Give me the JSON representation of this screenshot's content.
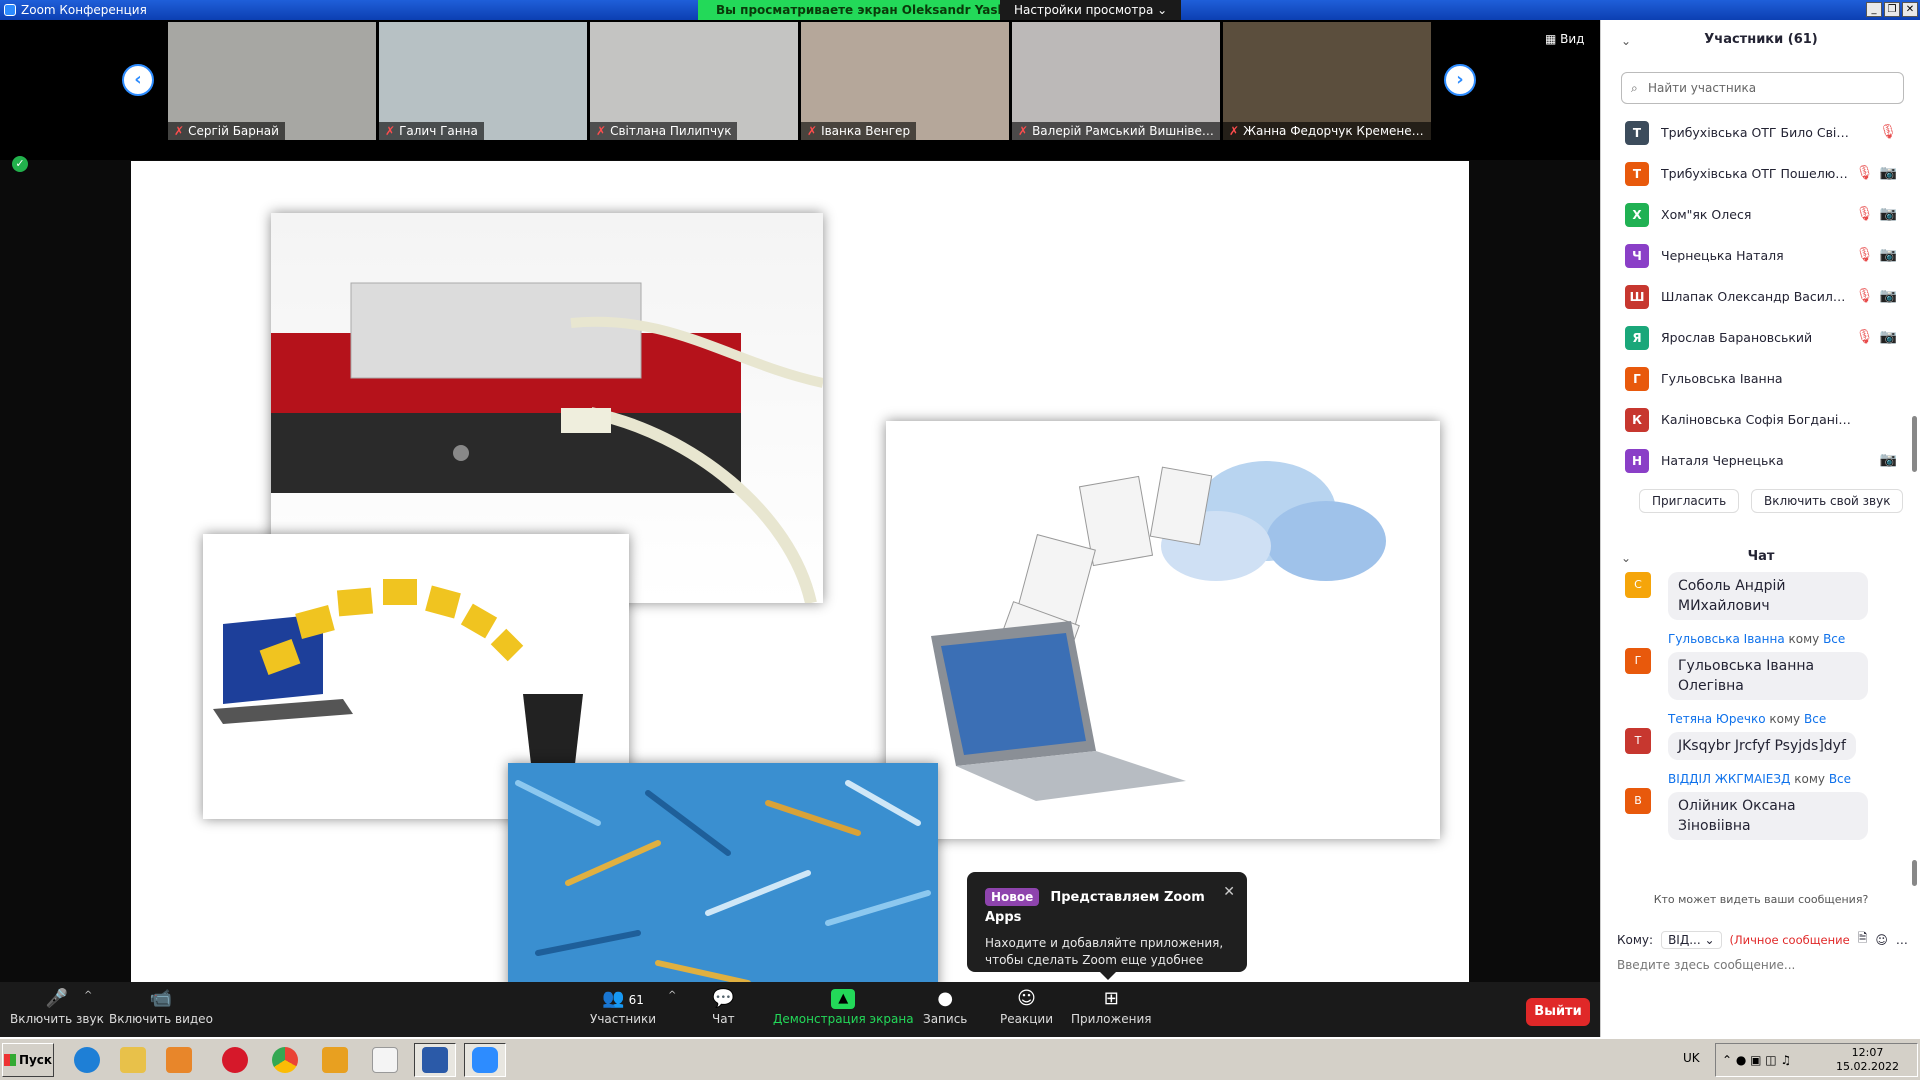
{
  "window": {
    "title": "Zoom Конференция",
    "min_glyph": "_",
    "max_glyph": "❐",
    "close_glyph": "✕"
  },
  "share_banner": "Вы просматриваете экран Oleksandr Yashchyk",
  "view_options": "Настройки просмотра ⌄",
  "view_button": "▦ Вид",
  "gallery": {
    "prev_glyph": "‹",
    "next_glyph": "›",
    "tiles": [
      {
        "name": "Сергій Барнай",
        "bg": "#a7a7a3"
      },
      {
        "name": "Галич Ганна",
        "bg": "#b7c1c4"
      },
      {
        "name": "Світлана Пилипчук",
        "bg": "#c4c4c2"
      },
      {
        "name": "Іванка Венгер",
        "bg": "#b5a79a"
      },
      {
        "name": "Валерій Рамський Вишнівець...",
        "bg": "#bcb9b8"
      },
      {
        "name": "Жанна Федорчук Кременець...",
        "bg": "#5b4e3d"
      }
    ],
    "mute_icon": "mic-off-icon",
    "mute_glyph": "✗"
  },
  "shield_glyph": "✓",
  "popup": {
    "badge": "Новое",
    "title": "Представляем Zoom Apps",
    "close_glyph": "✕",
    "text": "Находите и добавляйте приложения, чтобы сделать Zoom еще удобнее"
  },
  "toolbar": {
    "unmute": {
      "label": "Включить звук",
      "glyph": "🎤"
    },
    "start_video": {
      "label": "Включить видео",
      "glyph": "📹"
    },
    "participants": {
      "label": "Участники",
      "glyph": "👥",
      "count": "61"
    },
    "chat": {
      "label": "Чат",
      "glyph": "💬"
    },
    "share": {
      "label": "Демонстрация экрана",
      "glyph": "▲"
    },
    "record": {
      "label": "Запись",
      "glyph": "●"
    },
    "reactions": {
      "label": "Реакции",
      "glyph": "☺"
    },
    "apps": {
      "label": "Приложения",
      "glyph": "⊞"
    },
    "caret": "^",
    "leave": "Выйти",
    "accent_green": "#23d959",
    "leave_color": "#e02828"
  },
  "participants_panel": {
    "header": "Участники (61)",
    "collapse_glyph": "⌄",
    "search_placeholder": "Найти участника",
    "search_glyph": "⌕",
    "rows": [
      {
        "initial": "Т",
        "name": "Трибухівська ОТГ Било Світлана ...",
        "color": "#3c4c5c",
        "icons": "🎙"
      },
      {
        "initial": "Т",
        "name": "Трибухівська ОТГ Пошелюжн...",
        "color": "#e8590c",
        "icons": "🎙📷"
      },
      {
        "initial": "Х",
        "name": "Хом\"як Олеся",
        "color": "#20b153",
        "icons": "🎙📷"
      },
      {
        "initial": "Ч",
        "name": "Чернецька  Наталя",
        "color": "#8a3fc7",
        "icons": "🎙📷"
      },
      {
        "initial": "Ш",
        "name": "Шлапак Олександр Васильович",
        "color": "#c7372f",
        "icons": "🎙📷"
      },
      {
        "initial": "Я",
        "name": "Ярослав Барановський",
        "color": "#1aa77a",
        "icons": "🎙📷"
      },
      {
        "initial": "Г",
        "name": "Гульовська Іванна",
        "color": "#e8590c",
        "icons": ""
      },
      {
        "initial": "К",
        "name": "Каліновська Софія Богданівна",
        "color": "#c7372f",
        "icons": ""
      },
      {
        "initial": "Н",
        "name": "Наталя Чернецька",
        "color": "#8a3fc7",
        "icons": "📷"
      }
    ],
    "invite": "Пригласить",
    "unmute_me": "Включить свой звук"
  },
  "chat_panel": {
    "header": "Чат",
    "to_word": "кому",
    "messages": [
      {
        "initial": "С",
        "color": "#f5a50a",
        "sender": "",
        "to": "",
        "text": "Соболь Андрій МИхайлович"
      },
      {
        "initial": "Г",
        "color": "#e8590c",
        "sender": "Гульовська Іванна",
        "to": "Все",
        "text": "Гульовська Іванна Олегівна"
      },
      {
        "initial": "Т",
        "color": "#c7372f",
        "sender": "Тетяна Юречко",
        "to": "Все",
        "text": "JKsqybr Jrcfyf Psyjds]dyf"
      },
      {
        "initial": "В",
        "color": "#e8590c",
        "sender": "ВІДДІЛ ЖКГМАІЕЗД",
        "to": "Все",
        "text": "Олійник Оксана Зіновіівна"
      }
    ],
    "who_can_see": "Кто может видеть ваши сообщения?",
    "to_label": "Кому:",
    "to_value": "ВІД... ⌄",
    "private_label": "(Личное сообщение",
    "input_placeholder": "Введите здесь сообщение..."
  },
  "taskbar": {
    "start_label": "Пуск",
    "apps": [
      {
        "name": "ie",
        "color": "#1e7fd6"
      },
      {
        "name": "explorer",
        "color": "#e8c14a"
      },
      {
        "name": "media-player",
        "color": "#e8862a"
      },
      {
        "name": "opera",
        "color": "#d6182a"
      },
      {
        "name": "chrome",
        "color": "#34a853"
      },
      {
        "name": "reader",
        "color": "#e8a020"
      },
      {
        "name": "file",
        "color": "#f4f4f4"
      },
      {
        "name": "word",
        "color": "#2b5aa8"
      },
      {
        "name": "zoom",
        "color": "#2d8cff"
      }
    ],
    "lang": "UK",
    "time": "12:07",
    "date": "15.02.2022"
  }
}
